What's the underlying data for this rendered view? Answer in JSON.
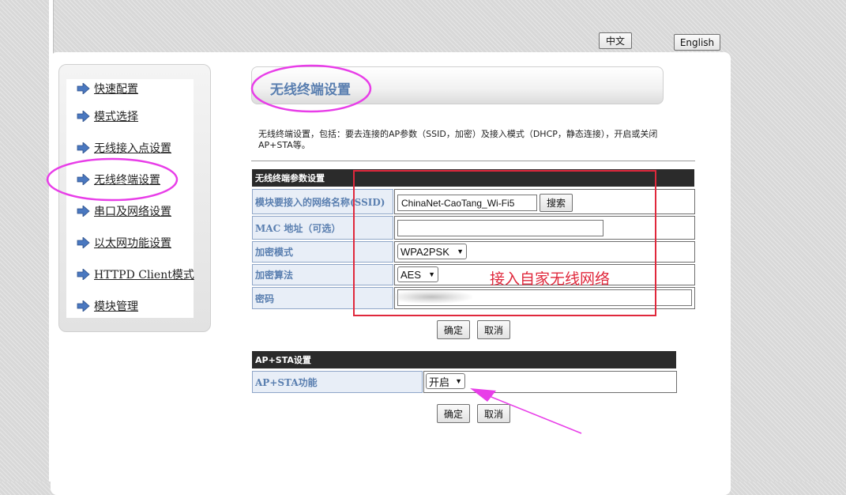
{
  "language": {
    "chinese": "中文",
    "english": "English"
  },
  "sidebar": {
    "items": [
      {
        "label": "快速配置",
        "icon": "arrow-right-icon"
      },
      {
        "label": "模式选择",
        "icon": "arrow-right-icon"
      },
      {
        "label": "无线接入点设置",
        "icon": "arrow-right-icon"
      },
      {
        "label": "无线终端设置",
        "icon": "arrow-right-icon"
      },
      {
        "label": "串口及网络设置",
        "icon": "arrow-right-icon"
      },
      {
        "label": "以太网功能设置",
        "icon": "arrow-right-icon"
      },
      {
        "label": "HTTPD Client模式",
        "icon": "arrow-right-icon"
      },
      {
        "label": "模块管理",
        "icon": "arrow-right-icon"
      }
    ]
  },
  "page": {
    "title": "无线终端设置",
    "description": "无线终端设置，包括：要去连接的AP参数（SSID，加密）及接入模式（DHCP，静态连接），开启或关闭 AP+STA等。"
  },
  "sta_section": {
    "header": "无线终端参数设置",
    "ssid_label": "模块要接入的网络名称(SSID)",
    "ssid_value": "ChinaNet-CaoTang_Wi-Fi5",
    "search_label": "搜索",
    "mac_label": "MAC 地址（可选）",
    "mac_value": "",
    "encryption_mode_label": "加密模式",
    "encryption_mode_value": "WPA2PSK",
    "encryption_algo_label": "加密算法",
    "encryption_algo_value": "AES",
    "password_label": "密码",
    "password_value": "",
    "confirm_label": "确定",
    "cancel_label": "取消"
  },
  "apsta_section": {
    "header": "AP+STA设置",
    "function_label": "AP+STA功能",
    "function_value": "开启",
    "confirm_label": "确定",
    "cancel_label": "取消"
  },
  "annotation": {
    "text": "接入自家无线网络",
    "color": "#e0283c",
    "highlight_color": "#e83ee8"
  }
}
